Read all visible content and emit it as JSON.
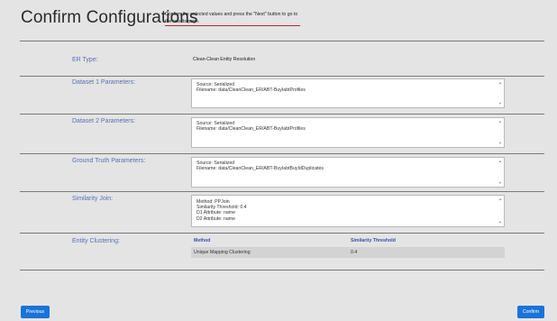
{
  "page": {
    "title": "Confirm Configurations",
    "hint": "Confirm the selected values and press the \"Next\" button to go to the results page."
  },
  "rows": {
    "er_type": {
      "label": "ER Type:",
      "value": "Clean-Clean Entity Resolution"
    },
    "dataset1": {
      "label": "Dataset 1 Parameters:",
      "lines": [
        "Source: Serialized",
        "Filename: data/CleanClean_ER/ABT-BuyIabtProfiles"
      ]
    },
    "dataset2": {
      "label": "Dataset 2 Parameters:",
      "lines": [
        "Source: Serialized",
        "Filename: data/CleanClean_ER/ABT-BuyIabtProfiles"
      ]
    },
    "ground_truth": {
      "label": "Ground Truth Parameters:",
      "lines": [
        "Source: Serialized",
        "Filename: data/CleanClean_ER/ABT-BuyIabtBuyIdDuplicates"
      ]
    },
    "similarity_join": {
      "label": "Similarity Join:",
      "lines": [
        "Method: PPJoin",
        "Similarity Threshold: 0.4",
        "D1 Attribute: name",
        "D2 Attribute: name"
      ]
    },
    "entity_clustering": {
      "label": "Entity Clustering:",
      "headers": [
        "Method",
        "Similarity Threshold"
      ],
      "row": [
        "Unique Mapping Clustering",
        "0.4"
      ]
    }
  },
  "buttons": {
    "previous": "Previous",
    "confirm": "Confirm"
  }
}
